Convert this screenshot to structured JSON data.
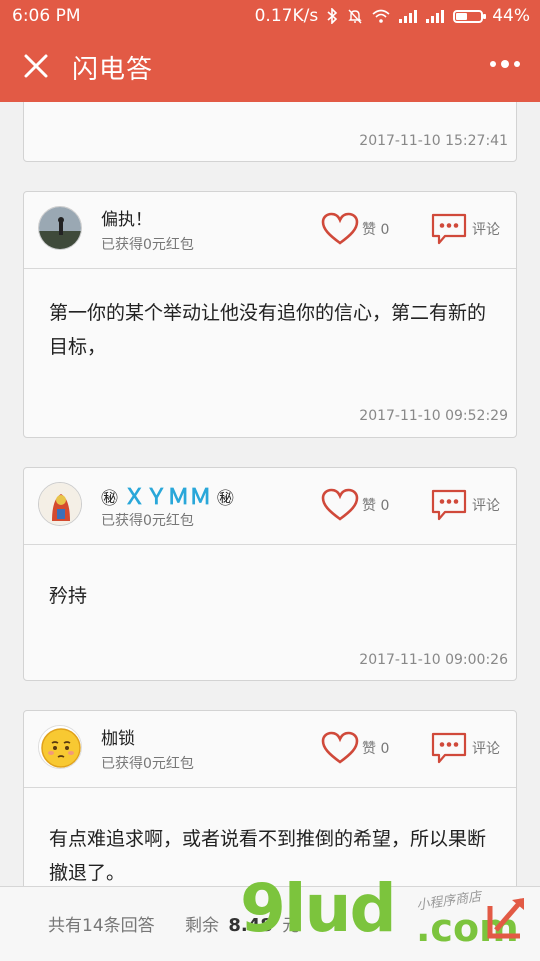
{
  "status_bar": {
    "time": "6:06 PM",
    "network_speed": "0.17K/s",
    "battery": "44%",
    "battery_level": 0.44,
    "icons": [
      "bluetooth-icon",
      "mute-bell-icon",
      "wifi-icon",
      "signal-icon",
      "signal-icon",
      "battery-icon"
    ]
  },
  "app_bar": {
    "title": "闪电答",
    "close_icon": "close-icon",
    "more_icon": "more-icon"
  },
  "answers": [
    {
      "partial": true,
      "timestamp": "2017-11-10 15:27:41"
    },
    {
      "username": "偏执！",
      "reward": "已获得0元红包",
      "like_label": "赞 0",
      "comment_label": "评论",
      "text": "第一你的某个举动让他没有追你的信心，第二有新的目标，",
      "timestamp": "2017-11-10 09:52:29"
    },
    {
      "username_prefix": "㊙",
      "username_core": "ＸＹＭＭ",
      "username_suffix": "㊙",
      "reward": "已获得0元红包",
      "like_label": "赞 0",
      "comment_label": "评论",
      "text": "矜持",
      "timestamp": "2017-11-10 09:00:26"
    },
    {
      "username": "枷锁",
      "reward": "已获得0元红包",
      "like_label": "赞 0",
      "comment_label": "评论",
      "text": "有点难追求啊，或者说看不到推倒的希望，所以果断撤退了。"
    }
  ],
  "footer": {
    "count_text": "共有14条回答",
    "remain_label": "剩余",
    "remain_amount": "8.48",
    "remain_unit": "元"
  },
  "watermark": {
    "big": "9lud",
    "com": ".com",
    "small": "小程序商店"
  },
  "colors": {
    "brand": "#e25a45",
    "heart": "#d0493a",
    "cyan_name": "#29a7d9",
    "watermark_green": "#7cc43d"
  }
}
